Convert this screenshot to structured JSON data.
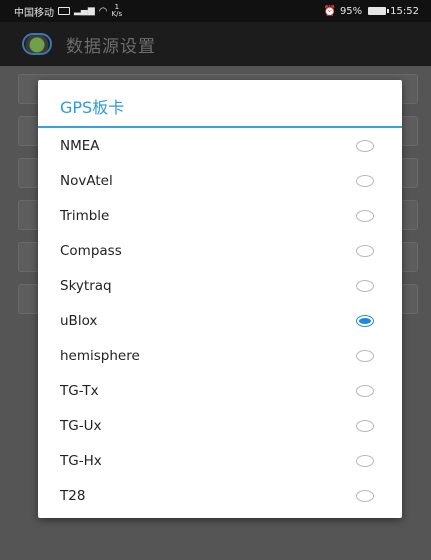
{
  "status_bar": {
    "carrier": "中国移动",
    "speed": "1\nK/s",
    "battery": "95%",
    "time": "15:52"
  },
  "app_bar": {
    "title": "数据源设置"
  },
  "dialog": {
    "title": "GPS板卡",
    "options": [
      {
        "label": "NMEA",
        "selected": false
      },
      {
        "label": "NovAtel",
        "selected": false
      },
      {
        "label": "Trimble",
        "selected": false
      },
      {
        "label": "Compass",
        "selected": false
      },
      {
        "label": "Skytraq",
        "selected": false
      },
      {
        "label": "uBlox",
        "selected": true
      },
      {
        "label": "hemisphere",
        "selected": false
      },
      {
        "label": "TG-Tx",
        "selected": false
      },
      {
        "label": "TG-Ux",
        "selected": false
      },
      {
        "label": "TG-Hx",
        "selected": false
      },
      {
        "label": "T28",
        "selected": false
      }
    ]
  },
  "colors": {
    "accent": "#2c9ad9",
    "radio_selected": "#1e88e5"
  }
}
